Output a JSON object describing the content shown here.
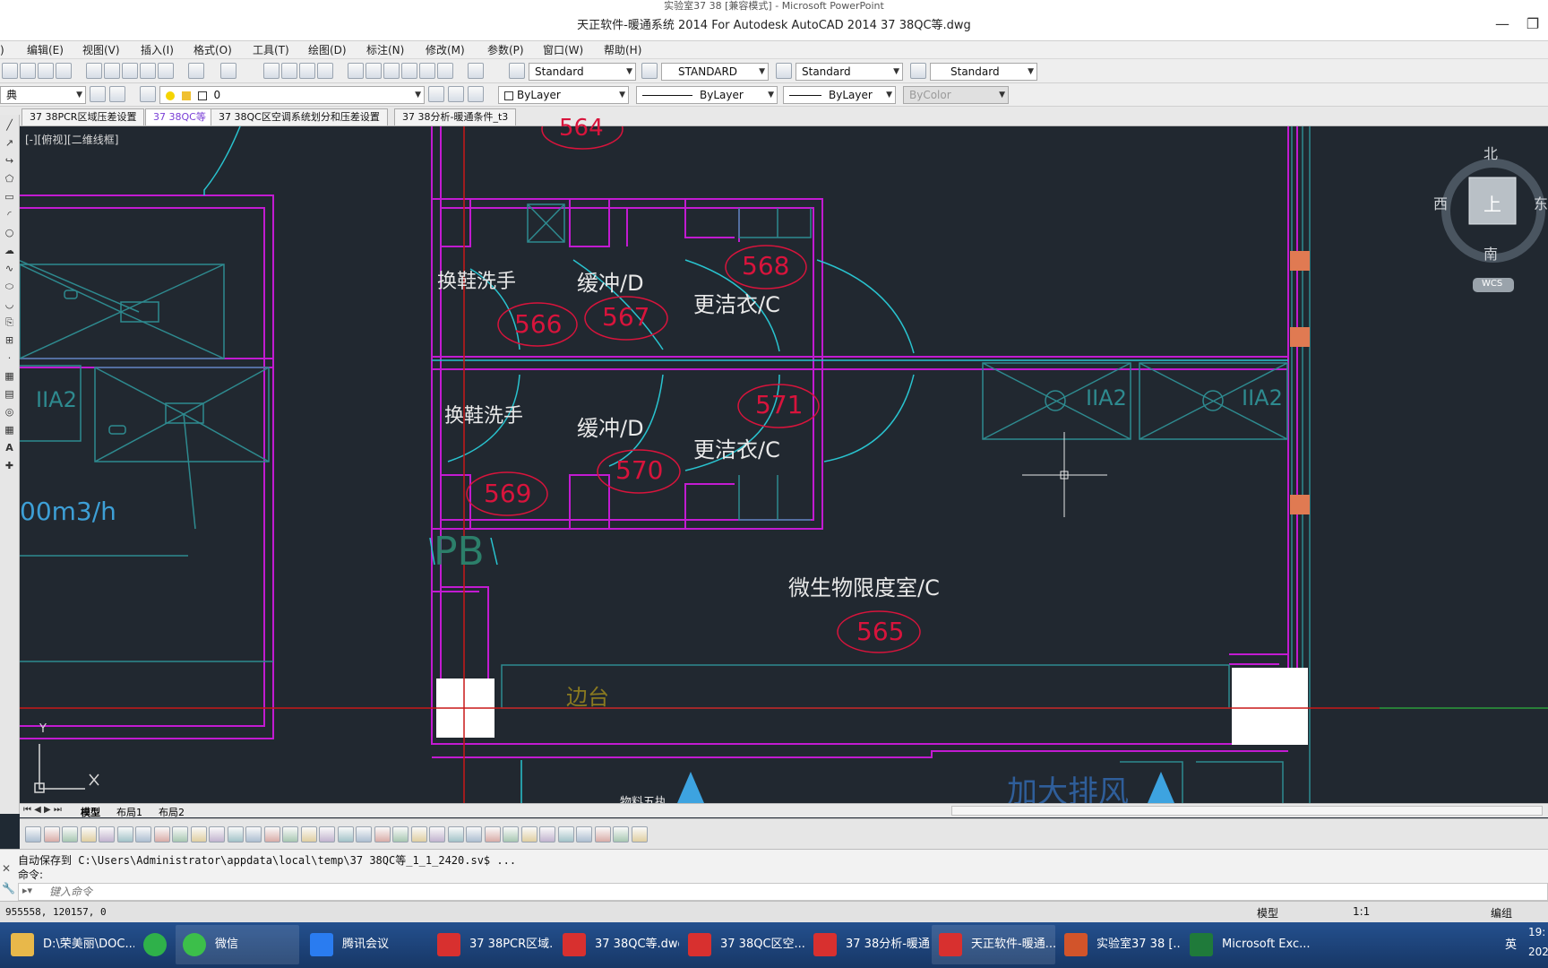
{
  "window": {
    "ppt_title": "实验室37 38 [兼容模式] - Microsoft PowerPoint",
    "app_title": "天正软件-暖通系统 2014 For Autodesk AutoCAD 2014      37 38QC等.dwg"
  },
  "menu": [
    "编辑(E)",
    "视图(V)",
    "插入(I)",
    "格式(O)",
    "工具(T)",
    "绘图(D)",
    "标注(N)",
    "修改(M)",
    "参数(P)",
    "窗口(W)",
    "帮助(H)"
  ],
  "styles_toolbar": {
    "text_style": "Standard",
    "dim_style": "STANDARD",
    "table_style": "Standard",
    "multileader_style": "Standard"
  },
  "layers_toolbar": {
    "workspace": "典",
    "layer": "0",
    "color": "ByLayer",
    "linetype": "ByLayer",
    "lineweight": "ByLayer",
    "plotstyle": "ByColor"
  },
  "file_tabs": [
    {
      "label": "37 38PCR区域压差设置",
      "active": false
    },
    {
      "label": "37 38QC等",
      "active": true
    },
    {
      "label": "37 38QC区空调系统划分和压差设置",
      "active": false
    },
    {
      "label": "37 38分析-暖通条件_t3",
      "active": false
    }
  ],
  "viewport_label": "[-][俯视][二维线框]",
  "drawing": {
    "rooms": [
      {
        "name": "换鞋洗手",
        "id": "566"
      },
      {
        "name": "缓冲/D",
        "id": "567"
      },
      {
        "name": "更洁衣/C",
        "id": "568"
      },
      {
        "name": "换鞋洗手",
        "id": "569"
      },
      {
        "name": "缓冲/D",
        "id": "570"
      },
      {
        "name": "更洁衣/C",
        "id": "571"
      },
      {
        "name": "微生物限度室/C",
        "id": "565"
      }
    ],
    "room_564": "564",
    "equipment_labels": [
      "IIA2",
      "IIA2",
      "IIA2"
    ],
    "flow_text": "00m3/h",
    "pb_label": "PB",
    "bench_label": "边台",
    "bottom_label": "加大排风",
    "bottom_label2": "物料五执"
  },
  "viewcube": {
    "north": "北",
    "south": "南",
    "west": "西",
    "east": "东",
    "face": "上",
    "wcs": "WCS"
  },
  "ucs": {
    "y": "Y",
    "x": "X"
  },
  "layout_tabs": [
    "模型",
    "布局1",
    "布局2"
  ],
  "command": {
    "history1": "自动保存到 C:\\Users\\Administrator\\appdata\\local\\temp\\37 38QC等_1_1_2420.sv$ ...",
    "history2": "命令:",
    "placeholder": "键入命令"
  },
  "status": {
    "coords": "955558, 120157, 0",
    "model": "模型",
    "scale": "1:1",
    "edit": "编组"
  },
  "taskbar": [
    {
      "label": "D:\\荣美丽\\DOC...",
      "color": "#e8b84a"
    },
    {
      "label": "",
      "color": "#2fb14a"
    },
    {
      "label": "微信",
      "color": "#3cbf4a"
    },
    {
      "label": "腾讯会议",
      "color": "#2a7cf0"
    },
    {
      "label": "37 38PCR区域...",
      "color": "#d8302f"
    },
    {
      "label": "37 38QC等.dwg",
      "color": "#d8302f"
    },
    {
      "label": "37 38QC区空...",
      "color": "#d8302f"
    },
    {
      "label": "37 38分析-暖通...",
      "color": "#d8302f"
    },
    {
      "label": "天正软件-暖通...",
      "color": "#d8302f"
    },
    {
      "label": "实验室37 38 [...",
      "color": "#d2542a"
    },
    {
      "label": "Microsoft Exc...",
      "color": "#1f7a3a"
    }
  ],
  "tray": {
    "ime": "英",
    "time": "19:",
    "date": "202"
  },
  "colors": {
    "wall": "#c21bd1",
    "door": "#29c3cf",
    "room_id": "#d8143c",
    "text": "#e8e8e8",
    "grid": "#2e8a8f"
  }
}
